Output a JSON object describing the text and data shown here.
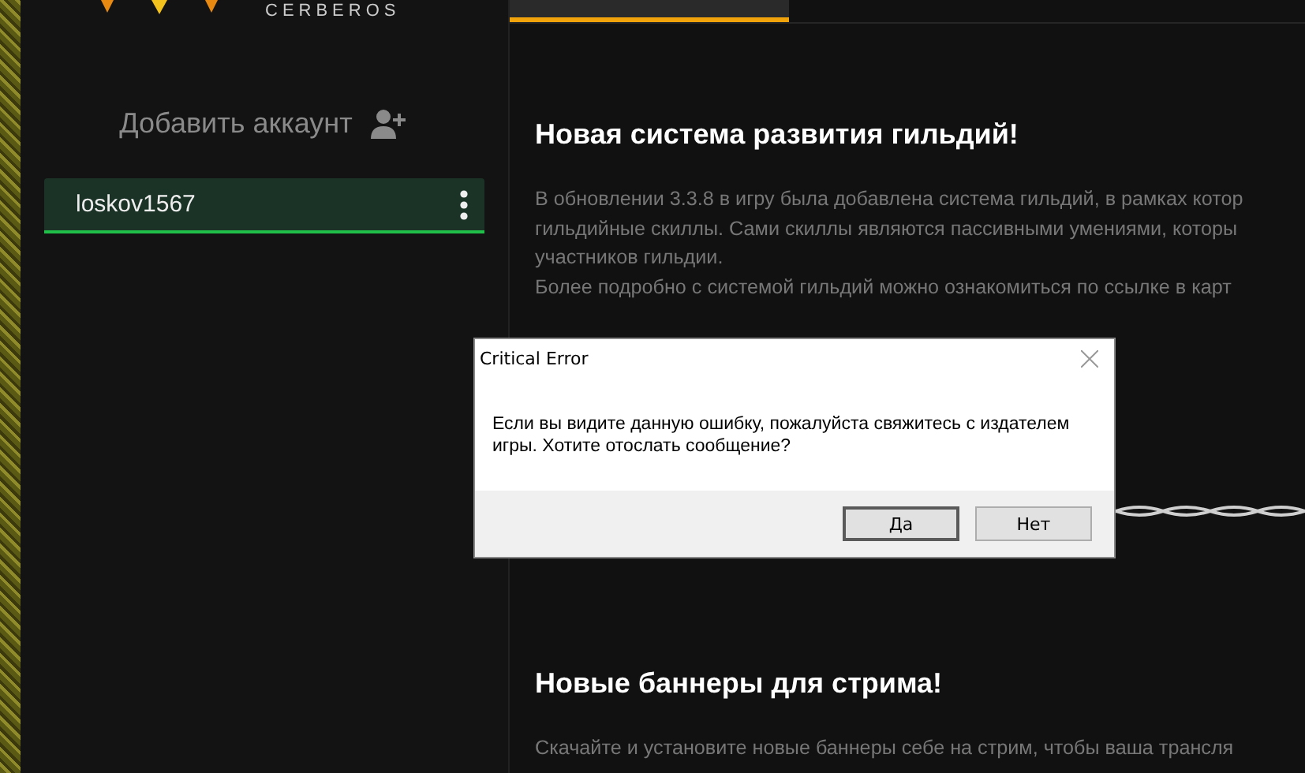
{
  "logo": {
    "text": "CERBEROS"
  },
  "sidebar": {
    "add_account": "Добавить аккаунт",
    "accounts": [
      {
        "name": "loskov1567",
        "selected": true
      }
    ]
  },
  "tabs": [
    {
      "selected": true
    }
  ],
  "articles": [
    {
      "title": "Новая система развития гильдий!",
      "lines": [
        "В обновлении 3.3.8 в игру была добавлена система гильдий, в рамках котор",
        "гильдийные скиллы. Сами скиллы являются пассивными умениями, которы",
        "участников гильдии.",
        "Более подробно с системой гильдий можно ознакомиться по ссылке в карт"
      ]
    },
    {
      "title": "Новые баннеры для стрима!",
      "lines": [
        "Скачайте и установите новые баннеры себе на стрим, чтобы ваша трансля"
      ]
    }
  ],
  "dialog": {
    "title": "Critical Error",
    "message": "Если вы видите данную ошибку, пожалуйста свяжитесь с издателем игры. Хотите отослать сообщение?",
    "buttons": [
      {
        "label": "Да",
        "selected": true
      },
      {
        "label": "Нет",
        "selected": false
      }
    ]
  }
}
